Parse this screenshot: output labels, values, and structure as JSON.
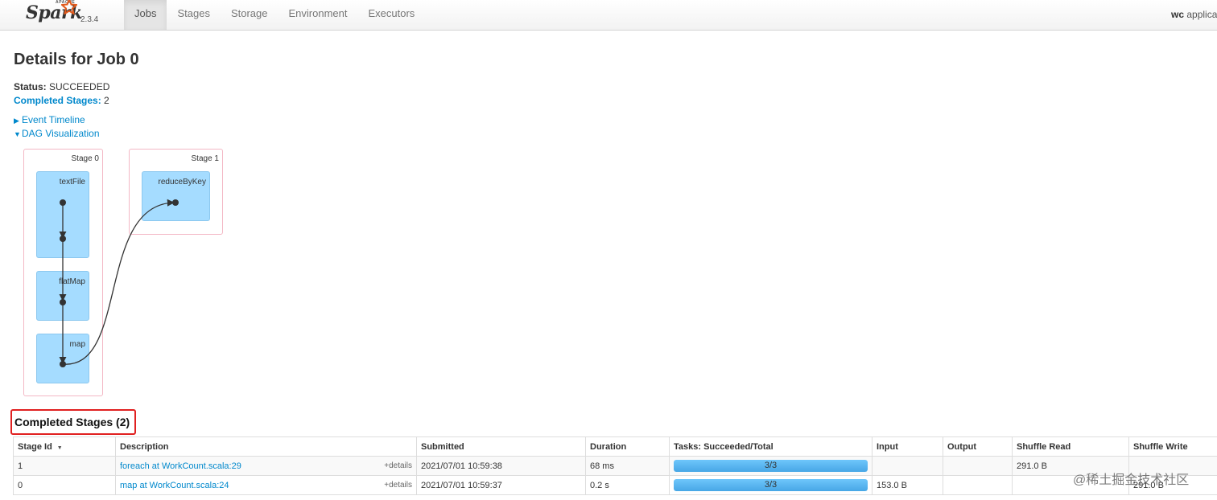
{
  "brand": {
    "apache": "APACHE",
    "name": "Spark",
    "version": "2.3.4"
  },
  "nav": {
    "tabs": [
      {
        "label": "Jobs",
        "active": true
      },
      {
        "label": "Stages",
        "active": false
      },
      {
        "label": "Storage",
        "active": false
      },
      {
        "label": "Environment",
        "active": false
      },
      {
        "label": "Executors",
        "active": false
      }
    ],
    "app_prefix": "wc",
    "app_suffix": "applica"
  },
  "page": {
    "title": "Details for Job 0",
    "status_label": "Status:",
    "status_value": "SUCCEEDED",
    "completed_label": "Completed Stages:",
    "completed_value": "2",
    "event_timeline": "Event Timeline",
    "dag_visualization": "DAG Visualization"
  },
  "dag": {
    "stages": [
      {
        "label": "Stage 0",
        "rdds": [
          "textFile",
          "flatMap",
          "map"
        ]
      },
      {
        "label": "Stage 1",
        "rdds": [
          "reduceByKey"
        ]
      }
    ]
  },
  "completed_stages": {
    "heading": "Completed Stages (2)",
    "columns": [
      "Stage Id",
      "Description",
      "Submitted",
      "Duration",
      "Tasks: Succeeded/Total",
      "Input",
      "Output",
      "Shuffle Read",
      "Shuffle Write"
    ],
    "details_label": "+details",
    "rows": [
      {
        "stage_id": "1",
        "description": "foreach at WorkCount.scala:29",
        "submitted": "2021/07/01 10:59:38",
        "duration": "68 ms",
        "tasks": "3/3",
        "tasks_fraction": 1.0,
        "input": "",
        "output": "",
        "shuffle_read": "291.0 B",
        "shuffle_write": ""
      },
      {
        "stage_id": "0",
        "description": "map at WorkCount.scala:24",
        "submitted": "2021/07/01 10:59:37",
        "duration": "0.2 s",
        "tasks": "3/3",
        "tasks_fraction": 1.0,
        "input": "153.0 B",
        "output": "",
        "shuffle_read": "",
        "shuffle_write": "291.0 B"
      }
    ]
  },
  "watermark": "@稀土掘金技术社区",
  "colors": {
    "link": "#0088cc",
    "rdd_fill": "#a5dcff",
    "stage_border": "#f3b8c5",
    "progress": "#52b3f0",
    "highlight": "#e02020"
  }
}
